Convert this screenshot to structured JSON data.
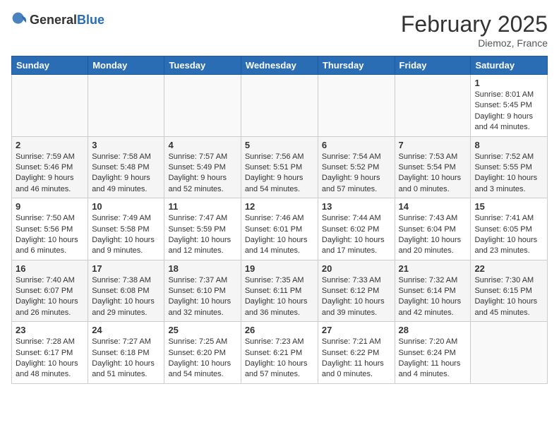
{
  "header": {
    "logo_general": "General",
    "logo_blue": "Blue",
    "month_title": "February 2025",
    "subtitle": "Diemoz, France"
  },
  "days_of_week": [
    "Sunday",
    "Monday",
    "Tuesday",
    "Wednesday",
    "Thursday",
    "Friday",
    "Saturday"
  ],
  "weeks": [
    [
      {
        "day": "",
        "info": ""
      },
      {
        "day": "",
        "info": ""
      },
      {
        "day": "",
        "info": ""
      },
      {
        "day": "",
        "info": ""
      },
      {
        "day": "",
        "info": ""
      },
      {
        "day": "",
        "info": ""
      },
      {
        "day": "1",
        "info": "Sunrise: 8:01 AM\nSunset: 5:45 PM\nDaylight: 9 hours and 44 minutes."
      }
    ],
    [
      {
        "day": "2",
        "info": "Sunrise: 7:59 AM\nSunset: 5:46 PM\nDaylight: 9 hours and 46 minutes."
      },
      {
        "day": "3",
        "info": "Sunrise: 7:58 AM\nSunset: 5:48 PM\nDaylight: 9 hours and 49 minutes."
      },
      {
        "day": "4",
        "info": "Sunrise: 7:57 AM\nSunset: 5:49 PM\nDaylight: 9 hours and 52 minutes."
      },
      {
        "day": "5",
        "info": "Sunrise: 7:56 AM\nSunset: 5:51 PM\nDaylight: 9 hours and 54 minutes."
      },
      {
        "day": "6",
        "info": "Sunrise: 7:54 AM\nSunset: 5:52 PM\nDaylight: 9 hours and 57 minutes."
      },
      {
        "day": "7",
        "info": "Sunrise: 7:53 AM\nSunset: 5:54 PM\nDaylight: 10 hours and 0 minutes."
      },
      {
        "day": "8",
        "info": "Sunrise: 7:52 AM\nSunset: 5:55 PM\nDaylight: 10 hours and 3 minutes."
      }
    ],
    [
      {
        "day": "9",
        "info": "Sunrise: 7:50 AM\nSunset: 5:56 PM\nDaylight: 10 hours and 6 minutes."
      },
      {
        "day": "10",
        "info": "Sunrise: 7:49 AM\nSunset: 5:58 PM\nDaylight: 10 hours and 9 minutes."
      },
      {
        "day": "11",
        "info": "Sunrise: 7:47 AM\nSunset: 5:59 PM\nDaylight: 10 hours and 12 minutes."
      },
      {
        "day": "12",
        "info": "Sunrise: 7:46 AM\nSunset: 6:01 PM\nDaylight: 10 hours and 14 minutes."
      },
      {
        "day": "13",
        "info": "Sunrise: 7:44 AM\nSunset: 6:02 PM\nDaylight: 10 hours and 17 minutes."
      },
      {
        "day": "14",
        "info": "Sunrise: 7:43 AM\nSunset: 6:04 PM\nDaylight: 10 hours and 20 minutes."
      },
      {
        "day": "15",
        "info": "Sunrise: 7:41 AM\nSunset: 6:05 PM\nDaylight: 10 hours and 23 minutes."
      }
    ],
    [
      {
        "day": "16",
        "info": "Sunrise: 7:40 AM\nSunset: 6:07 PM\nDaylight: 10 hours and 26 minutes."
      },
      {
        "day": "17",
        "info": "Sunrise: 7:38 AM\nSunset: 6:08 PM\nDaylight: 10 hours and 29 minutes."
      },
      {
        "day": "18",
        "info": "Sunrise: 7:37 AM\nSunset: 6:10 PM\nDaylight: 10 hours and 32 minutes."
      },
      {
        "day": "19",
        "info": "Sunrise: 7:35 AM\nSunset: 6:11 PM\nDaylight: 10 hours and 36 minutes."
      },
      {
        "day": "20",
        "info": "Sunrise: 7:33 AM\nSunset: 6:12 PM\nDaylight: 10 hours and 39 minutes."
      },
      {
        "day": "21",
        "info": "Sunrise: 7:32 AM\nSunset: 6:14 PM\nDaylight: 10 hours and 42 minutes."
      },
      {
        "day": "22",
        "info": "Sunrise: 7:30 AM\nSunset: 6:15 PM\nDaylight: 10 hours and 45 minutes."
      }
    ],
    [
      {
        "day": "23",
        "info": "Sunrise: 7:28 AM\nSunset: 6:17 PM\nDaylight: 10 hours and 48 minutes."
      },
      {
        "day": "24",
        "info": "Sunrise: 7:27 AM\nSunset: 6:18 PM\nDaylight: 10 hours and 51 minutes."
      },
      {
        "day": "25",
        "info": "Sunrise: 7:25 AM\nSunset: 6:20 PM\nDaylight: 10 hours and 54 minutes."
      },
      {
        "day": "26",
        "info": "Sunrise: 7:23 AM\nSunset: 6:21 PM\nDaylight: 10 hours and 57 minutes."
      },
      {
        "day": "27",
        "info": "Sunrise: 7:21 AM\nSunset: 6:22 PM\nDaylight: 11 hours and 0 minutes."
      },
      {
        "day": "28",
        "info": "Sunrise: 7:20 AM\nSunset: 6:24 PM\nDaylight: 11 hours and 4 minutes."
      },
      {
        "day": "",
        "info": ""
      }
    ]
  ]
}
